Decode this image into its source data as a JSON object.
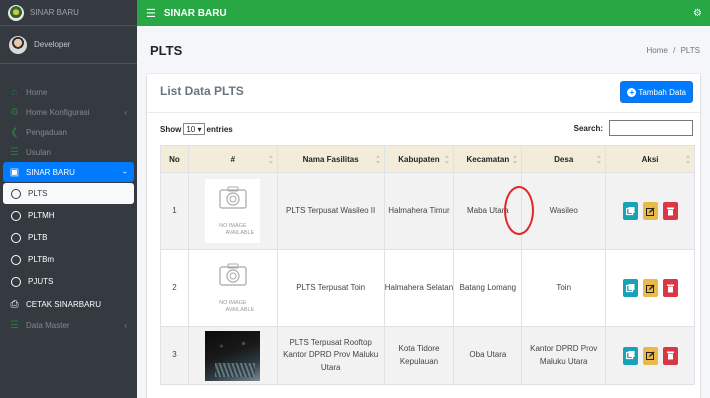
{
  "brand": {
    "name": "SINAR BARU"
  },
  "user": {
    "name": "Developer"
  },
  "sidebar": {
    "items": [
      {
        "label": "Home",
        "icon": "home-icon"
      },
      {
        "label": "Home Konfigurasi",
        "icon": "cogs-icon"
      },
      {
        "label": "Pengaduan",
        "icon": "bullhorn-icon"
      },
      {
        "label": "Usulan",
        "icon": "list-icon"
      },
      {
        "label": "SINAR BARU",
        "icon": "building-icon"
      },
      {
        "label": "CETAK SINARBARU",
        "icon": "print-icon"
      },
      {
        "label": "Data Master",
        "icon": "database-icon"
      }
    ],
    "sub_items": [
      "PLTS",
      "PLTMH",
      "PLTB",
      "PLTBm",
      "PJUTS"
    ]
  },
  "topbar": {
    "title": "SINAR BARU"
  },
  "page": {
    "title": "PLTS",
    "breadcrumb": {
      "home": "Home",
      "separator": "/",
      "current": "PLTS"
    }
  },
  "card": {
    "title": "List Data PLTS",
    "add_button": "Tambah Data",
    "length_prefix": "Show",
    "length_value": "10",
    "length_suffix": "entries",
    "search_label": "Search:",
    "search_value": ""
  },
  "table": {
    "headers": [
      "No",
      "#",
      "Nama Fasilitas",
      "Kabupaten",
      "Kecamatan",
      "Desa",
      "Aksi"
    ],
    "no_image_line1": "NO IMAGE",
    "no_image_line2": "AVAILABLE",
    "rows": [
      {
        "no": "1",
        "nama": "PLTS Terpusat Wasileo II",
        "kabupaten": "Halmahera Timur",
        "kecamatan": "Maba Utara",
        "desa": "Wasileo"
      },
      {
        "no": "2",
        "nama": "PLTS Terpusat Toin",
        "kabupaten": "Halmahera Selatan",
        "kecamatan": "Batang Lomang",
        "desa": "Toin"
      },
      {
        "no": "3",
        "nama": "PLTS Terpusat Rooftop Kantor DPRD Prov Maluku Utara",
        "kabupaten": "Kota Tidore Kepulauan",
        "kecamatan": "Oba Utara",
        "desa": "Kantor DPRD Prov Maluku Utara"
      }
    ]
  },
  "colors": {
    "topbar": "#28a745",
    "sidebar": "#343a40",
    "primary": "#007bff",
    "table_header": "#f2ecd9",
    "view_button": "#17a2b8",
    "edit_button": "#e9b949",
    "delete_button": "#dc3545",
    "highlight": "#e3262a"
  }
}
